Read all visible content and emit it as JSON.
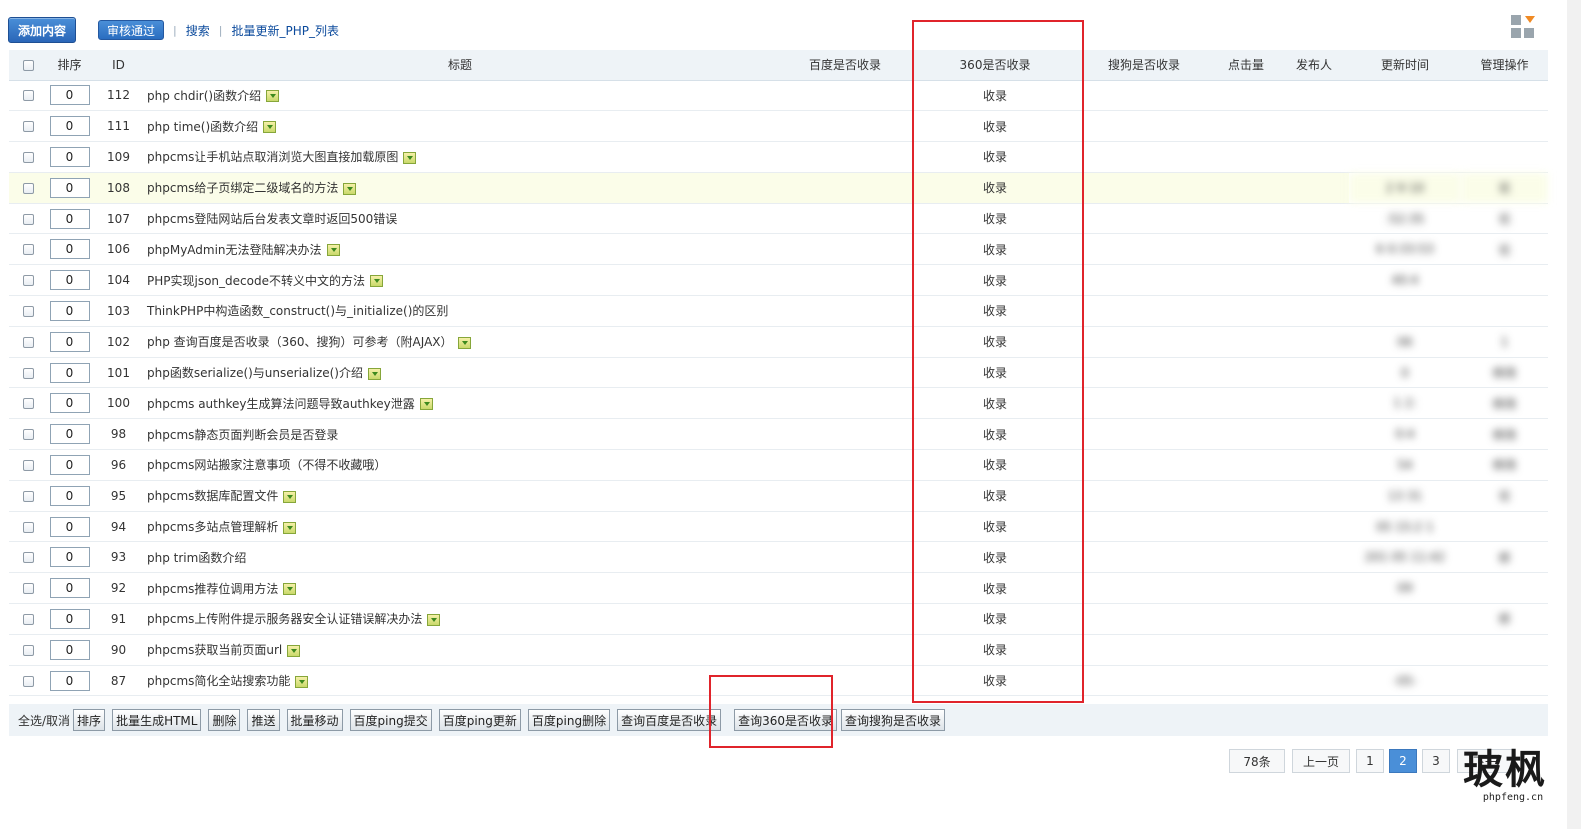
{
  "toolbar": {
    "add_label": "添加内容",
    "audit_label": "审核通过",
    "sep": "|",
    "search_label": "搜索",
    "batch_label": "批量更新_PHP_列表"
  },
  "columns": {
    "sort": "排序",
    "id": "ID",
    "title": "标题",
    "baidu": "百度是否收录",
    "s360": "360是否收录",
    "sogou": "搜狗是否收录",
    "hits": "点击量",
    "author": "发布人",
    "updated": "更新时间",
    "manage": "管理操作"
  },
  "rows": [
    {
      "order": "0",
      "id": "112",
      "title": "php chdir()函数介绍",
      "pic": true,
      "s360": "收录"
    },
    {
      "order": "0",
      "id": "111",
      "title": "php time()函数介绍",
      "pic": true,
      "s360": "收录"
    },
    {
      "order": "0",
      "id": "109",
      "title": "phpcms让手机站点取消浏览大图直接加载原图",
      "pic": true,
      "s360": "收录"
    },
    {
      "order": "0",
      "id": "108",
      "title": "phpcms给子页绑定二级域名的方法",
      "pic": true,
      "s360": "收录",
      "highlight": true,
      "blur_time": "2 9 10",
      "blur_manage": "论"
    },
    {
      "order": "0",
      "id": "107",
      "title": "phpcms登陆网站后台发表文章时返回500错误",
      "pic": false,
      "s360": "收录",
      "blur_time": ":52:35",
      "blur_manage": "论"
    },
    {
      "order": "0",
      "id": "106",
      "title": "phpMyAdmin无法登陆解决办法",
      "pic": true,
      "s360": "收录",
      "blur_time": "6 0:33:53",
      "blur_manage": "论"
    },
    {
      "order": "0",
      "id": "104",
      "title": "PHP实现json_decode不转义中文的方法",
      "pic": true,
      "s360": "收录",
      "blur_time": "40:4"
    },
    {
      "order": "0",
      "id": "103",
      "title": "ThinkPHP中构造函数_construct()与_initialize()的区别",
      "pic": false,
      "s360": "收录"
    },
    {
      "order": "0",
      "id": "102",
      "title": "php 查询百度是否收录（360、搜狗）可参考（附AJAX）",
      "pic": true,
      "s360": "收录",
      "blur_time": "06",
      "blur_manage": "1"
    },
    {
      "order": "0",
      "id": "101",
      "title": "php函数serialize()与unserialize()介绍",
      "pic": true,
      "s360": "收录",
      "blur_time": "0",
      "blur_manage": "修改"
    },
    {
      "order": "0",
      "id": "100",
      "title": "phpcms authkey生成算法问题导致authkey泄露",
      "pic": true,
      "s360": "收录",
      "blur_time": "1 2:",
      "blur_manage": "修改"
    },
    {
      "order": "0",
      "id": "98",
      "title": "phpcms静态页面判断会员是否登录",
      "pic": false,
      "s360": "收录",
      "blur_time": "0:4",
      "blur_manage": "修改"
    },
    {
      "order": "0",
      "id": "96",
      "title": "phpcms网站搬家注意事项（不得不收藏哦）",
      "pic": false,
      "s360": "收录",
      "blur_time": "54",
      "blur_manage": "修改"
    },
    {
      "order": "0",
      "id": "95",
      "title": "phpcms数据库配置文件",
      "pic": true,
      "s360": "收录",
      "blur_time": "13 31",
      "blur_manage": "论"
    },
    {
      "order": "0",
      "id": "94",
      "title": "phpcms多站点管理解析",
      "pic": true,
      "s360": "收录",
      "blur_time": "05 15:2 1"
    },
    {
      "order": "0",
      "id": "93",
      "title": "php trim函数介绍",
      "pic": false,
      "s360": "收录",
      "blur_time": "201 05 11:42",
      "blur_manage": "修"
    },
    {
      "order": "0",
      "id": "92",
      "title": "phpcms推荐位调用方法",
      "pic": true,
      "s360": "收录",
      "blur_time": "09"
    },
    {
      "order": "0",
      "id": "91",
      "title": "phpcms上传附件提示服务器安全认证错误解决办法",
      "pic": true,
      "s360": "收录",
      "blur_manage": "修"
    },
    {
      "order": "0",
      "id": "90",
      "title": "phpcms获取当前页面url",
      "pic": true,
      "s360": "收录"
    },
    {
      "order": "0",
      "id": "87",
      "title": "phpcms简化全站搜索功能",
      "pic": true,
      "s360": "收录",
      "blur_time": "-05-"
    }
  ],
  "bottom": {
    "select_all": "全选/取消",
    "buttons": [
      "排序",
      "批量生成HTML",
      "删除",
      "推送",
      "批量移动",
      "百度ping提交",
      "百度ping更新",
      "百度ping删除",
      "查询百度是否收录",
      "查询360是否收录",
      "查询搜狗是否收录"
    ]
  },
  "pager": {
    "total": "78条",
    "prev": "上一页",
    "pages": [
      "1",
      "2",
      "3"
    ],
    "current": "2",
    "next": "下一"
  },
  "logo": {
    "text": "玻枫",
    "url_text": "phpfeng.cn"
  },
  "colors": {
    "highlight_box": "#e0242b",
    "accent": "#4a8fd8",
    "link": "#0b4a9c"
  }
}
